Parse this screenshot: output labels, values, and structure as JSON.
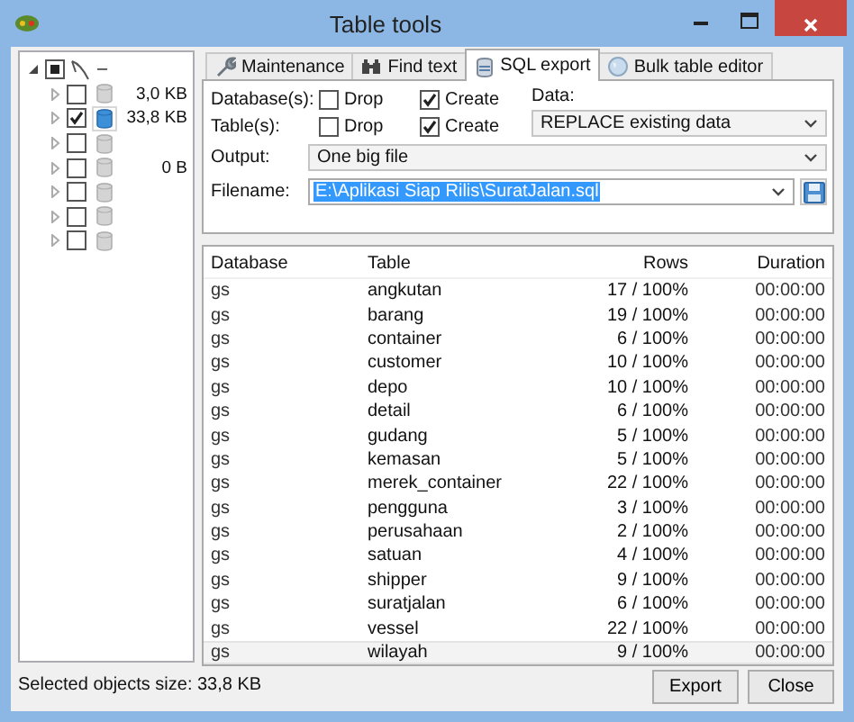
{
  "window": {
    "title": "Table tools"
  },
  "tree": {
    "label": "–",
    "partial": true,
    "expanded": true,
    "children": [
      {
        "size": "3,0 KB",
        "checked": false,
        "selected": false,
        "expanded": false
      },
      {
        "size": "33,8 KB",
        "checked": true,
        "selected": true,
        "expanded": false
      },
      {
        "checked": false,
        "selected": false,
        "expanded": false
      },
      {
        "size": "0 B",
        "checked": false,
        "selected": false,
        "expanded": false
      },
      {
        "checked": false,
        "selected": false,
        "expanded": false
      },
      {
        "checked": false,
        "selected": false,
        "expanded": false
      },
      {
        "checked": false,
        "selected": false,
        "expanded": false
      }
    ]
  },
  "tabs": [
    {
      "label": "Maintenance",
      "kind": "wrench",
      "selected": false
    },
    {
      "label": "Find text",
      "kind": "binoculars",
      "selected": false
    },
    {
      "label": "SQL export",
      "kind": "database",
      "selected": true
    },
    {
      "label": "Bulk table editor",
      "kind": "globe",
      "selected": false
    }
  ],
  "export_options": [
    {
      "label": "Database(s):",
      "checkboxes": [
        {
          "label": "Drop",
          "checked": false
        },
        {
          "label": "Create",
          "checked": true
        }
      ]
    },
    {
      "label": "Table(s):",
      "checkboxes": [
        {
          "label": "Drop",
          "checked": false
        },
        {
          "label": "Create",
          "checked": true
        }
      ]
    }
  ],
  "data": {
    "label": "Data:",
    "value": "REPLACE existing data"
  },
  "output": {
    "label": "Output:",
    "value": "One big file"
  },
  "filename": {
    "label": "Filename:",
    "value": "E:\\Aplikasi Siap Rilis\\SuratJalan.sql"
  },
  "table": {
    "columns": [
      "Database",
      "Table",
      "Rows",
      "Duration"
    ],
    "rows": [
      {
        "cells": [
          "gs",
          "angkutan",
          "17 / 100%",
          "00:00:00"
        ],
        "selected": false
      },
      {
        "cells": [
          "gs",
          "barang",
          "19 / 100%",
          "00:00:00"
        ],
        "selected": false
      },
      {
        "cells": [
          "gs",
          "container",
          "6 / 100%",
          "00:00:00"
        ],
        "selected": false
      },
      {
        "cells": [
          "gs",
          "customer",
          "10 / 100%",
          "00:00:00"
        ],
        "selected": false
      },
      {
        "cells": [
          "gs",
          "depo",
          "10 / 100%",
          "00:00:00"
        ],
        "selected": false
      },
      {
        "cells": [
          "gs",
          "detail",
          "6 / 100%",
          "00:00:00"
        ],
        "selected": false
      },
      {
        "cells": [
          "gs",
          "gudang",
          "5 / 100%",
          "00:00:00"
        ],
        "selected": false
      },
      {
        "cells": [
          "gs",
          "kemasan",
          "5 / 100%",
          "00:00:00"
        ],
        "selected": false
      },
      {
        "cells": [
          "gs",
          "merek_container",
          "22 / 100%",
          "00:00:00"
        ],
        "selected": false
      },
      {
        "cells": [
          "gs",
          "pengguna",
          "3 / 100%",
          "00:00:00"
        ],
        "selected": false
      },
      {
        "cells": [
          "gs",
          "perusahaan",
          "2 / 100%",
          "00:00:00"
        ],
        "selected": false
      },
      {
        "cells": [
          "gs",
          "satuan",
          "4 / 100%",
          "00:00:00"
        ],
        "selected": false
      },
      {
        "cells": [
          "gs",
          "shipper",
          "9 / 100%",
          "00:00:00"
        ],
        "selected": false
      },
      {
        "cells": [
          "gs",
          "suratjalan",
          "6 / 100%",
          "00:00:00"
        ],
        "selected": false
      },
      {
        "cells": [
          "gs",
          "vessel",
          "22 / 100%",
          "00:00:00"
        ],
        "selected": false
      },
      {
        "cells": [
          "gs",
          "wilayah",
          "9 / 100%",
          "00:00:00"
        ],
        "selected": true
      }
    ]
  },
  "status_bar": "Selected objects size: 33,8 KB",
  "buttons": [
    "Export",
    "Close"
  ]
}
